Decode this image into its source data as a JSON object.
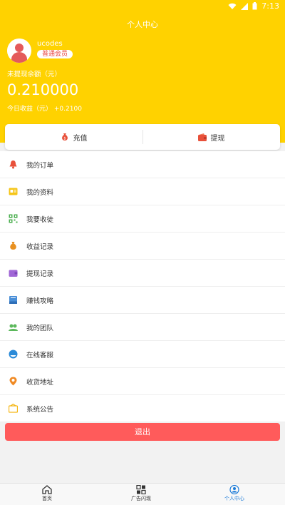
{
  "status": {
    "time": "7:13"
  },
  "header": {
    "title": "个人中心",
    "username": "ucodes",
    "badge": "普通会员",
    "balance_label": "未提现余额（元）",
    "balance_value": "0.210000",
    "today_label": "今日收益（元）",
    "today_value": "+0.2100"
  },
  "actions": {
    "recharge": "充值",
    "withdraw": "提现"
  },
  "menu": [
    {
      "label": "我的订单",
      "icon": "bell-icon",
      "color": "#e8503a"
    },
    {
      "label": "我的资料",
      "icon": "profile-card-icon",
      "color": "#f5c518"
    },
    {
      "label": "我要收徒",
      "icon": "qr-code-icon",
      "color": "#4caf50"
    },
    {
      "label": "收益记录",
      "icon": "money-bag-icon",
      "color": "#e89020"
    },
    {
      "label": "提现记录",
      "icon": "wallet-icon",
      "color": "#a066d6"
    },
    {
      "label": "赚钱攻略",
      "icon": "book-icon",
      "color": "#4a8fd8"
    },
    {
      "label": "我的团队",
      "icon": "team-icon",
      "color": "#5cb85c"
    },
    {
      "label": "在线客服",
      "icon": "customer-service-icon",
      "color": "#2a8ad8"
    },
    {
      "label": "收货地址",
      "icon": "location-pin-icon",
      "color": "#f08a24"
    },
    {
      "label": "系统公告",
      "icon": "notice-icon",
      "color": "#f5b818"
    }
  ],
  "logout": "退出",
  "tabs": [
    {
      "label": "首页",
      "icon": "home-icon"
    },
    {
      "label": "广告闪现",
      "icon": "grid-icon"
    },
    {
      "label": "个人中心",
      "icon": "person-icon",
      "active_color": "#1a7ad8"
    }
  ]
}
